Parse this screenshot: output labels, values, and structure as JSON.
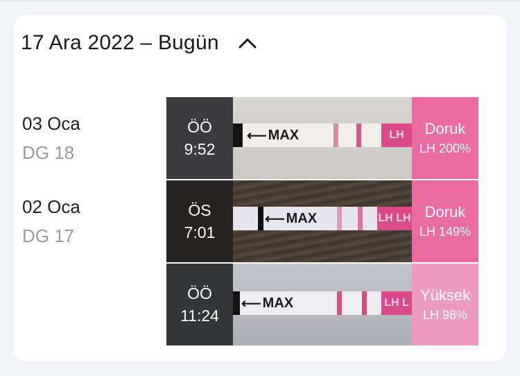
{
  "header": {
    "title": "17 Ara 2022 – Bugün",
    "toggle_icon": "chevron-up-icon"
  },
  "days": [
    {
      "date": "03 Oca",
      "cycle_day": "DG 18"
    },
    {
      "date": "02 Oca",
      "cycle_day": "DG 17"
    }
  ],
  "entries": [
    {
      "period": "ÖÖ",
      "time": "9:52",
      "strip_text": "MAX",
      "strip_tab": "LH",
      "result": "Doruk",
      "lh": "LH 200%",
      "colors": {
        "time_bg": "#3b3b3d",
        "photo_bg": "#cfcdc7",
        "result_bg": "#e96ba2"
      }
    },
    {
      "period": "ÖS",
      "time": "7:01",
      "strip_text": "MAX",
      "strip_tab": "LH LH",
      "result": "Doruk",
      "lh": "LH 149%",
      "colors": {
        "time_bg": "#252322",
        "photo_bg": "#4a3f35",
        "result_bg": "#e96ba2"
      }
    },
    {
      "period": "ÖÖ",
      "time": "11:24",
      "strip_text": "MAX",
      "strip_tab": "LH L",
      "result": "Yüksek",
      "lh": "LH 98%",
      "colors": {
        "time_bg": "#353638",
        "photo_bg": "#b9b9bf",
        "result_bg": "#ec9ac0"
      }
    }
  ]
}
